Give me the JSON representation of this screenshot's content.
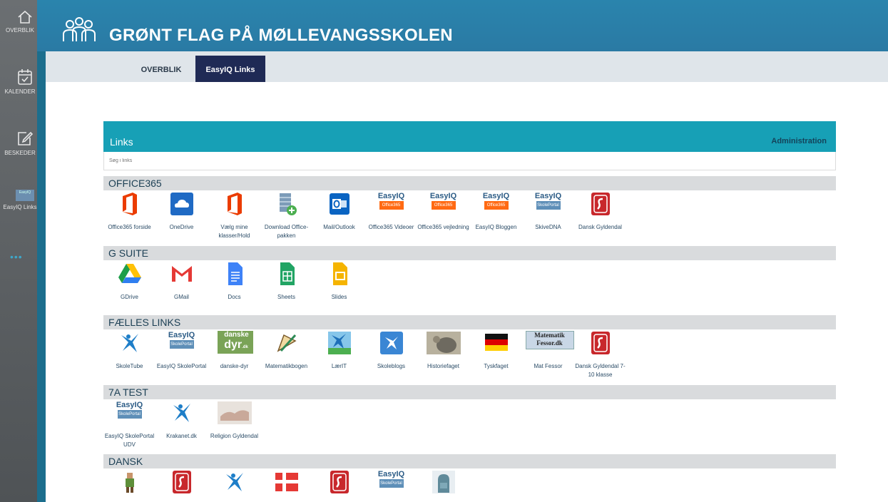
{
  "sidebar": {
    "items": [
      {
        "label": "OVERBLIK",
        "icon": "home-icon"
      },
      {
        "label": "KALENDER",
        "icon": "calendar-icon"
      },
      {
        "label": "BESKEDER",
        "icon": "edit-message-icon"
      },
      {
        "label": "EasyIQ Links",
        "icon": "easyiq-logo-icon"
      }
    ],
    "more": "•••"
  },
  "header": {
    "title": "GRØNT FLAG PÅ MØLLEVANGSSKOLEN",
    "icon": "people-group-icon"
  },
  "tabs": [
    {
      "label": "OVERBLIK",
      "active": false
    },
    {
      "label": "EasyIQ Links",
      "active": true
    }
  ],
  "links": {
    "title": "Links",
    "admin": "Administration",
    "search_placeholder": "Søg i links"
  },
  "sections": [
    {
      "title": "OFFICE365",
      "items": [
        {
          "label": "Office365 forside",
          "icon": "office365-icon"
        },
        {
          "label": "OneDrive",
          "icon": "onedrive-icon"
        },
        {
          "label": "Vælg mine klasser/Hold",
          "icon": "office365-icon"
        },
        {
          "label": "Download Office-pakken",
          "icon": "database-download-icon"
        },
        {
          "label": "Mail/Outlook",
          "icon": "outlook-icon"
        },
        {
          "label": "Office365 Videoer",
          "icon": "easyiq-office365-icon"
        },
        {
          "label": "Office365 vejledning",
          "icon": "easyiq-office365-icon"
        },
        {
          "label": "EasyIQ Bloggen",
          "icon": "easyiq-office365-icon"
        },
        {
          "label": "SkiveDNA",
          "icon": "easyiq-skoleportal-icon"
        },
        {
          "label": "Dansk Gyldendal",
          "icon": "gyldendal-icon"
        }
      ]
    },
    {
      "title": "G SUITE",
      "items": [
        {
          "label": "GDrive",
          "icon": "gdrive-icon"
        },
        {
          "label": "GMail",
          "icon": "gmail-icon"
        },
        {
          "label": "Docs",
          "icon": "docs-icon"
        },
        {
          "label": "Sheets",
          "icon": "sheets-icon"
        },
        {
          "label": "Slides",
          "icon": "slides-icon"
        }
      ]
    },
    {
      "title": "FÆLLES LINKS",
      "items": [
        {
          "label": "SkoleTube",
          "icon": "bird-icon"
        },
        {
          "label": "EasyIQ SkolePortal",
          "icon": "easyiq-skoleportal-icon"
        },
        {
          "label": "danske-dyr",
          "icon": "danske-dyr-icon"
        },
        {
          "label": "Matematikbogen",
          "icon": "protractor-icon"
        },
        {
          "label": "LærIT",
          "icon": "bird-landscape-icon"
        },
        {
          "label": "Skoleblogs",
          "icon": "bird-square-icon"
        },
        {
          "label": "Historiefaget",
          "icon": "history-photo-icon"
        },
        {
          "label": "Tyskfaget",
          "icon": "german-flag-icon"
        },
        {
          "label": "Mat Fessor",
          "icon": "matematikfessor-icon"
        },
        {
          "label": "Dansk Gyldendal 7-10 klasse",
          "icon": "gyldendal-icon"
        }
      ]
    },
    {
      "title": "7A TEST",
      "items": [
        {
          "label": "EasyIQ SkolePortal UDV",
          "icon": "easyiq-skoleportal-icon"
        },
        {
          "label": "Krakanet.dk",
          "icon": "bird-icon"
        },
        {
          "label": "Religion Gyldendal",
          "icon": "religion-photo-icon"
        }
      ]
    },
    {
      "title": "DANSK",
      "items": [
        {
          "label": "",
          "icon": "figure-icon"
        },
        {
          "label": "",
          "icon": "gyldendal-icon"
        },
        {
          "label": "",
          "icon": "bird-icon"
        },
        {
          "label": "",
          "icon": "danish-flag-icon"
        },
        {
          "label": "",
          "icon": "gyldendal-icon"
        },
        {
          "label": "",
          "icon": "easyiq-skoleportal-icon"
        },
        {
          "label": "",
          "icon": "backpack-icon"
        }
      ]
    }
  ],
  "easyiq_text": {
    "brand": "EasyIQ",
    "office": "Office365",
    "portal": "SkolePortal",
    "dyr": "danske",
    "dyr2": "dyr",
    "fessor": "Matematik Fessor.dk"
  },
  "colors": {
    "header": "#2a84ad",
    "tab_active": "#1f2a55",
    "links_bar": "#17a0b6",
    "section_bar": "#d9dbdd"
  }
}
